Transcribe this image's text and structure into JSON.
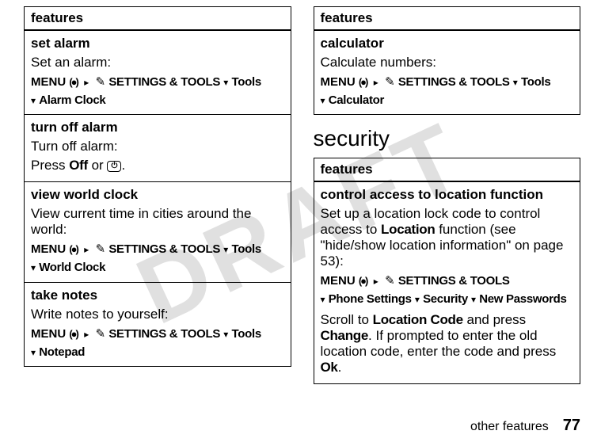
{
  "watermark": "DRAFT",
  "left_table": {
    "header": "features",
    "rows": [
      {
        "title": "set alarm",
        "desc": "Set an alarm:",
        "menu_prefix": "MENU",
        "settings_tools": "SETTINGS & TOOLS",
        "tools": "Tools",
        "last": "Alarm Clock"
      },
      {
        "title": "turn off alarm",
        "desc": "Turn off alarm:",
        "press_label": "Press",
        "off": "Off",
        "or": "or",
        "period": "."
      },
      {
        "title": "view world clock",
        "desc": "View current time in cities around the world:",
        "menu_prefix": "MENU",
        "settings_tools": "SETTINGS & TOOLS",
        "tools": "Tools",
        "last": "World Clock"
      },
      {
        "title": "take notes",
        "desc": "Write notes to yourself:",
        "menu_prefix": "MENU",
        "settings_tools": "SETTINGS & TOOLS",
        "tools": "Tools",
        "last": "Notepad"
      }
    ]
  },
  "right_table1": {
    "header": "features",
    "row": {
      "title": "calculator",
      "desc": "Calculate numbers:",
      "menu_prefix": "MENU",
      "settings_tools": "SETTINGS & TOOLS",
      "tools": "Tools",
      "last": "Calculator"
    }
  },
  "security_heading": "security",
  "right_table2": {
    "header": "features",
    "row": {
      "title": "control access to location function",
      "desc1_a": "Set up a location lock code to control access to ",
      "desc1_b": "Location",
      "desc1_c": " function (see \"hide/show location information\" on page 53):",
      "menu_prefix": "MENU",
      "settings_tools": "SETTINGS & TOOLS",
      "phone_settings": "Phone Settings",
      "security": "Security",
      "new_passwords": "New Passwords",
      "desc2_a": "Scroll to ",
      "desc2_b": "Location Code",
      "desc2_c": " and press ",
      "desc2_d": "Change",
      "desc2_e": ". If prompted to enter the old location code, enter the code and press ",
      "desc2_f": "Ok",
      "desc2_g": "."
    }
  },
  "footer": {
    "section": "other features",
    "page": "77"
  }
}
